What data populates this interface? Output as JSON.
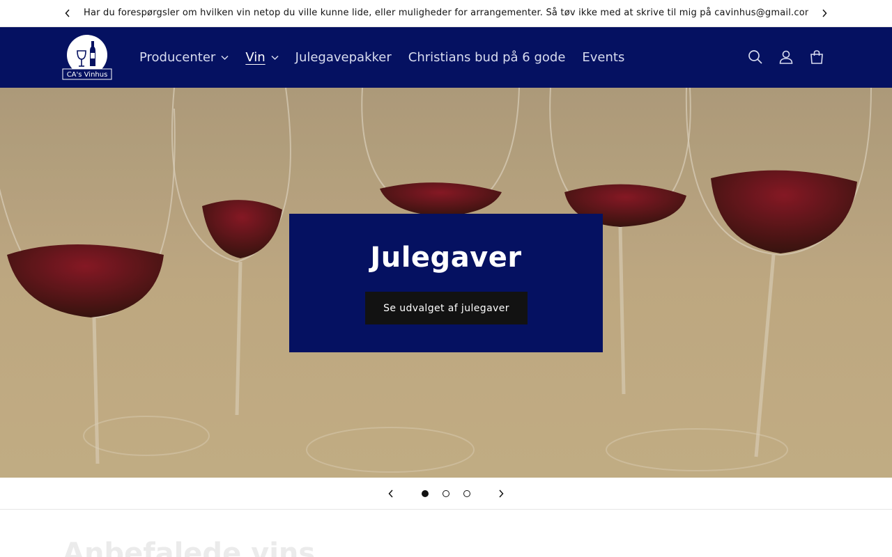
{
  "announcement": {
    "message": "Har du forespørgsler om hvilken vin netop du ville kunne lide, eller muligheder for arrangementer. Så tøv ikke med at skrive til mig på cavinhus@gmail.com"
  },
  "header": {
    "logo_text": "CA's Vinhus",
    "nav": [
      {
        "label": "Producenter",
        "has_dropdown": true
      },
      {
        "label": "Vin",
        "has_dropdown": true,
        "active": true
      },
      {
        "label": "Julegavepakker"
      },
      {
        "label": "Christians bud på 6 gode"
      },
      {
        "label": "Events"
      }
    ],
    "icons": [
      "search-icon",
      "account-icon",
      "cart-icon"
    ]
  },
  "hero": {
    "title": "Julegaver",
    "button_label": "Se udvalget af julegaver"
  },
  "slider": {
    "slide_count": 3,
    "active_index": 0
  },
  "section": {
    "title": "Anbefalede vins"
  },
  "colors": {
    "header_bg": "#051161",
    "button_bg": "#121212",
    "text": "#121212"
  }
}
